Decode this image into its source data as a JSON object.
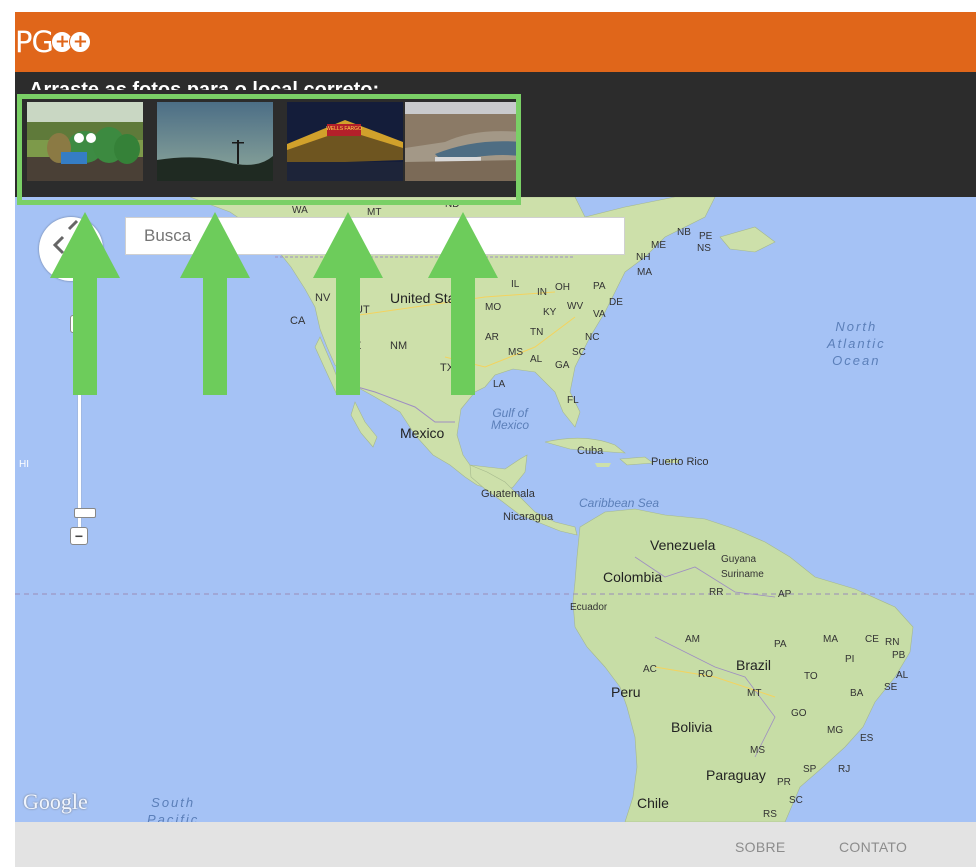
{
  "app": {
    "logo_text": "PG"
  },
  "photobar": {
    "instruction": "Arraste as fotos para o local correto:",
    "photos": [
      {
        "name": "frog-statues-photo"
      },
      {
        "name": "dusk-field-photo"
      },
      {
        "name": "wells-fargo-photo",
        "text": "WELLS FARGO"
      },
      {
        "name": "dam-canyon-photo"
      }
    ]
  },
  "search": {
    "placeholder": "Busca"
  },
  "zoom": {
    "in": "+",
    "out": "−"
  },
  "map": {
    "labels": {
      "wa": "WA",
      "mt": "MT",
      "nd": "ND",
      "nv": "NV",
      "ut": "UT",
      "ca": "CA",
      "az": "AZ",
      "nm": "NM",
      "tx": "TX",
      "united_states": "United States",
      "il": "IL",
      "in": "IN",
      "oh": "OH",
      "pa": "PA",
      "mo": "MO",
      "ky": "KY",
      "wv": "WV",
      "va": "VA",
      "de": "DE",
      "ar": "AR",
      "tn": "TN",
      "nc": "NC",
      "ms": "MS",
      "al": "AL",
      "ga": "GA",
      "sc": "SC",
      "la": "LA",
      "fl": "FL",
      "nh": "NH",
      "me": "ME",
      "ma": "MA",
      "nb": "NB",
      "pe": "PE",
      "ns": "NS",
      "north_atlantic": "North\nAtlantic\nOcean",
      "gulf": "Gulf of\nMexico",
      "mexico": "Mexico",
      "cuba": "Cuba",
      "puerto_rico": "Puerto Rico",
      "hi": "HI",
      "guatemala": "Guatemala",
      "caribbean": "Caribbean Sea",
      "nicaragua": "Nicaragua",
      "venezuela": "Venezuela",
      "guyana": "Guyana",
      "suriname": "Suriname",
      "colombia": "Colombia",
      "rr": "RR",
      "ap": "AP",
      "ecuador": "Ecuador",
      "am": "AM",
      "pa_br": "PA",
      "ma_br": "MA",
      "ce": "CE",
      "rn": "RN",
      "pi": "PI",
      "pb": "PB",
      "brazil": "Brazil",
      "ac": "AC",
      "ro": "RO",
      "to": "TO",
      "al_br": "AL",
      "se": "SE",
      "ba": "BA",
      "peru": "Peru",
      "mt_br": "MT",
      "go": "GO",
      "bolivia": "Bolivia",
      "mg": "MG",
      "es": "ES",
      "ms_br": "MS",
      "paraguay": "Paraguay",
      "sp": "SP",
      "rj": "RJ",
      "pr": "PR",
      "chile": "Chile",
      "sc_br": "SC",
      "rs": "RS",
      "south_pacific": "South\nPacific",
      "google": "Google"
    }
  },
  "footer": {
    "sobre": "SOBRE",
    "contato": "CONTATO"
  },
  "colors": {
    "header": "#e0661a",
    "photobar": "#2c2c2c",
    "highlight": "#7ad066",
    "water": "#a5c2f5",
    "land": "#c9dfa8",
    "footer": "#e3e3e3"
  }
}
